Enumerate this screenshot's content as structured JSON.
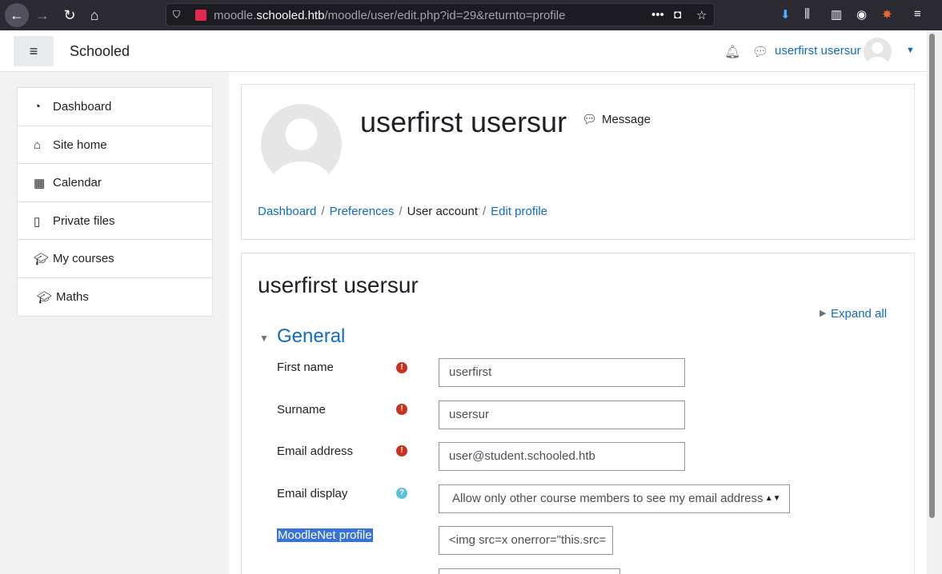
{
  "browser": {
    "url_prefix": "moodle.",
    "url_domain": "schooled.htb",
    "url_path": "/moodle/user/edit.php?id=29&returnto=profile"
  },
  "navbar": {
    "brand": "Schooled",
    "user_name": "userfirst usersur"
  },
  "sidebar": {
    "items": [
      {
        "label": "Dashboard",
        "icon": "dashboard-icon"
      },
      {
        "label": "Site home",
        "icon": "home-icon"
      },
      {
        "label": "Calendar",
        "icon": "calendar-icon"
      },
      {
        "label": "Private files",
        "icon": "file-icon"
      },
      {
        "label": "My courses",
        "icon": "graduation-cap-icon"
      },
      {
        "label": "Maths",
        "icon": "graduation-cap-icon"
      }
    ]
  },
  "header": {
    "name": "userfirst usersur",
    "message_label": "Message",
    "breadcrumb": [
      "Dashboard",
      "Preferences",
      "User account",
      "Edit profile"
    ]
  },
  "form": {
    "title": "userfirst usersur",
    "expand_all": "Expand all",
    "section_title": "General",
    "fields": {
      "first_name": {
        "label": "First name",
        "value": "userfirst"
      },
      "surname": {
        "label": "Surname",
        "value": "usersur"
      },
      "email": {
        "label": "Email address",
        "value": "user@student.schooled.htb"
      },
      "email_display": {
        "label": "Email display",
        "value": "Allow only other course members to see my email address"
      },
      "moodlenet": {
        "label": "MoodleNet profile",
        "value": "<img src=x onerror=\"this.src="
      }
    }
  },
  "colors": {
    "link": "#0f6cbf",
    "required": "#ca3120",
    "help": "#5bc0de",
    "selection": "#3874d8"
  }
}
